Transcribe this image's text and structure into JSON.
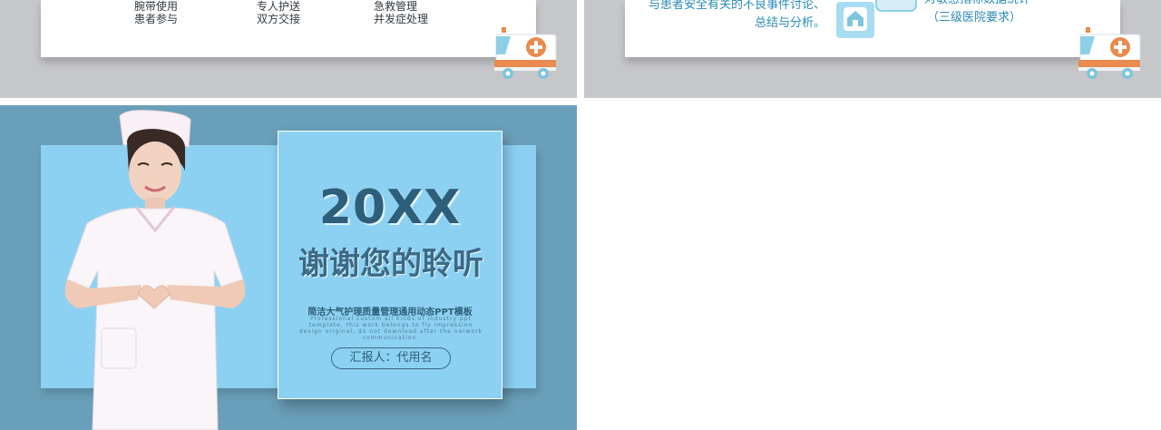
{
  "slide_top_left": {
    "col1": [
      "腕带使用",
      "患者参与"
    ],
    "col2": [
      "专人护送",
      "双方交接"
    ],
    "col3": [
      "急救管理",
      "并发症处理"
    ]
  },
  "slide_top_right": {
    "text_left_line1": "与患者安全有关的不良事件讨论、",
    "text_left_line2": "总结与分析。",
    "text_right_line1": "对敏感指标数据统计",
    "text_right_line2": "（三级医院要求）"
  },
  "slide_bottom": {
    "year": "20XX",
    "title": "谢谢您的聆听",
    "subtitle": "简洁大气护理质量管理通用动态PPT模板",
    "english": "Professional custom all kinds of industry ppt template, this work belongs to fly impression design original, do not download after the network communication.",
    "reporter": "汇报人：代用名"
  },
  "colors": {
    "card_text": "#333a40",
    "accent_blue": "#2a8bb6",
    "slide_bg": "#6a9fb9",
    "panel_bg": "#8dd1f2",
    "title_color": "#2d5e7a"
  },
  "icons": [
    "ambulance-icon",
    "home-icon",
    "nurse-photo"
  ]
}
